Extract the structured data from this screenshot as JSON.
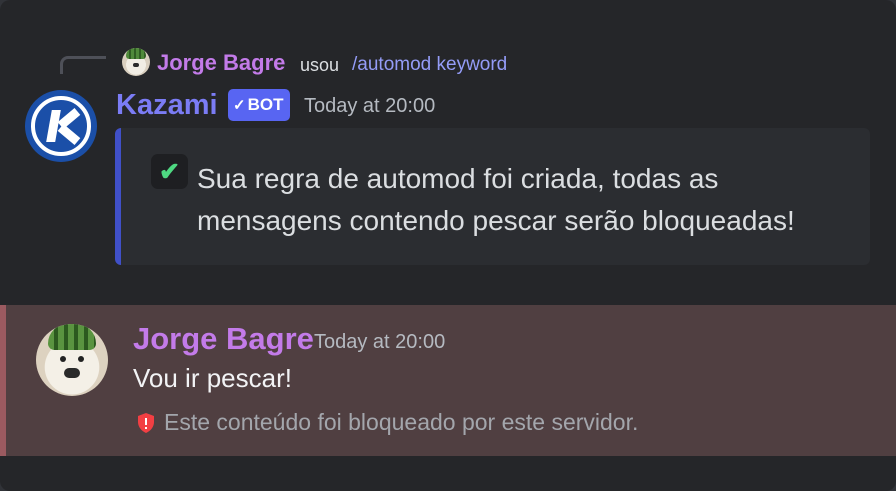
{
  "reply": {
    "author": "Jorge Bagre",
    "used_label": "usou",
    "command": "/automod keyword"
  },
  "bot_message": {
    "author": "Kazami",
    "tag": "BOT",
    "timestamp": "Today at 20:00",
    "embed_text": "Sua regra de automod foi criada, todas as mensagens contendo pescar serão bloqueadas!",
    "embed_accent": "#4050c8",
    "icon": "check-icon"
  },
  "blocked_message": {
    "author": "Jorge Bagre",
    "timestamp": "Today at 20:00",
    "content": "Vou ir pescar!",
    "notice": "Este conteúdo foi bloqueado por este servidor.",
    "icon": "shield-alert-icon",
    "highlight_color": "#503f41"
  },
  "colors": {
    "background": "#252629",
    "user_name": "#c37be9",
    "bot_name": "#7b7cf5",
    "bot_tag": "#5865f2",
    "check": "#4ed982",
    "shield": "#f23f43"
  }
}
